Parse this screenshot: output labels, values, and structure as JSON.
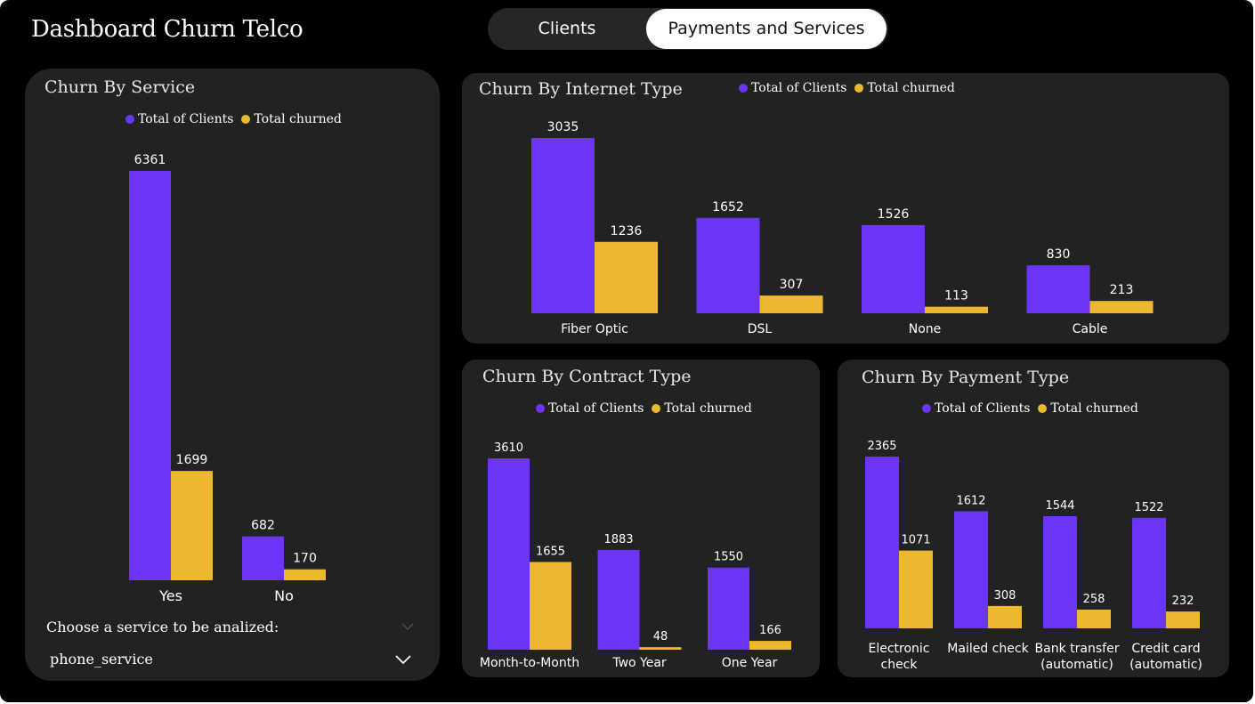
{
  "dashboard": {
    "title": "Dashboard Churn Telco",
    "tabs": [
      "Clients",
      "Payments and Services"
    ],
    "active_tab": "Payments and Services"
  },
  "colors": {
    "total": "#6a35f5",
    "churned": "#ebb830",
    "panel": "#222222",
    "background": "#000000"
  },
  "legend": {
    "total": "Total of Clients",
    "churned": "Total churned"
  },
  "slicer": {
    "label": "Choose a service to be analized:",
    "value": "phone_service"
  },
  "chart_data": [
    {
      "id": "service",
      "type": "bar",
      "title": "Churn By Service",
      "categories": [
        "Yes",
        "No"
      ],
      "series": [
        {
          "name": "Total of Clients",
          "values": [
            6361,
            682
          ]
        },
        {
          "name": "Total churned",
          "values": [
            1699,
            170
          ]
        }
      ],
      "legend_position": "top"
    },
    {
      "id": "internet",
      "type": "bar",
      "title": "Churn By Internet Type",
      "categories": [
        "Fiber Optic",
        "DSL",
        "None",
        "Cable"
      ],
      "series": [
        {
          "name": "Total of Clients",
          "values": [
            3035,
            1652,
            1526,
            830
          ]
        },
        {
          "name": "Total churned",
          "values": [
            1236,
            307,
            113,
            213
          ]
        }
      ],
      "legend_position": "top-right"
    },
    {
      "id": "contract",
      "type": "bar",
      "title": "Churn By Contract Type",
      "categories": [
        "Month-to-Month",
        "Two Year",
        "One Year"
      ],
      "series": [
        {
          "name": "Total of Clients",
          "values": [
            3610,
            1883,
            1550
          ]
        },
        {
          "name": "Total churned",
          "values": [
            1655,
            48,
            166
          ]
        }
      ],
      "legend_position": "top"
    },
    {
      "id": "payment",
      "type": "bar",
      "title": "Churn By Payment Type",
      "categories": [
        [
          "Electronic",
          "check"
        ],
        [
          "Mailed check"
        ],
        [
          "Bank transfer",
          "(automatic)"
        ],
        [
          "Credit card",
          "(automatic)"
        ]
      ],
      "series": [
        {
          "name": "Total of Clients",
          "values": [
            2365,
            1612,
            1544,
            1522
          ]
        },
        {
          "name": "Total churned",
          "values": [
            1071,
            308,
            258,
            232
          ]
        }
      ],
      "legend_position": "top"
    }
  ]
}
